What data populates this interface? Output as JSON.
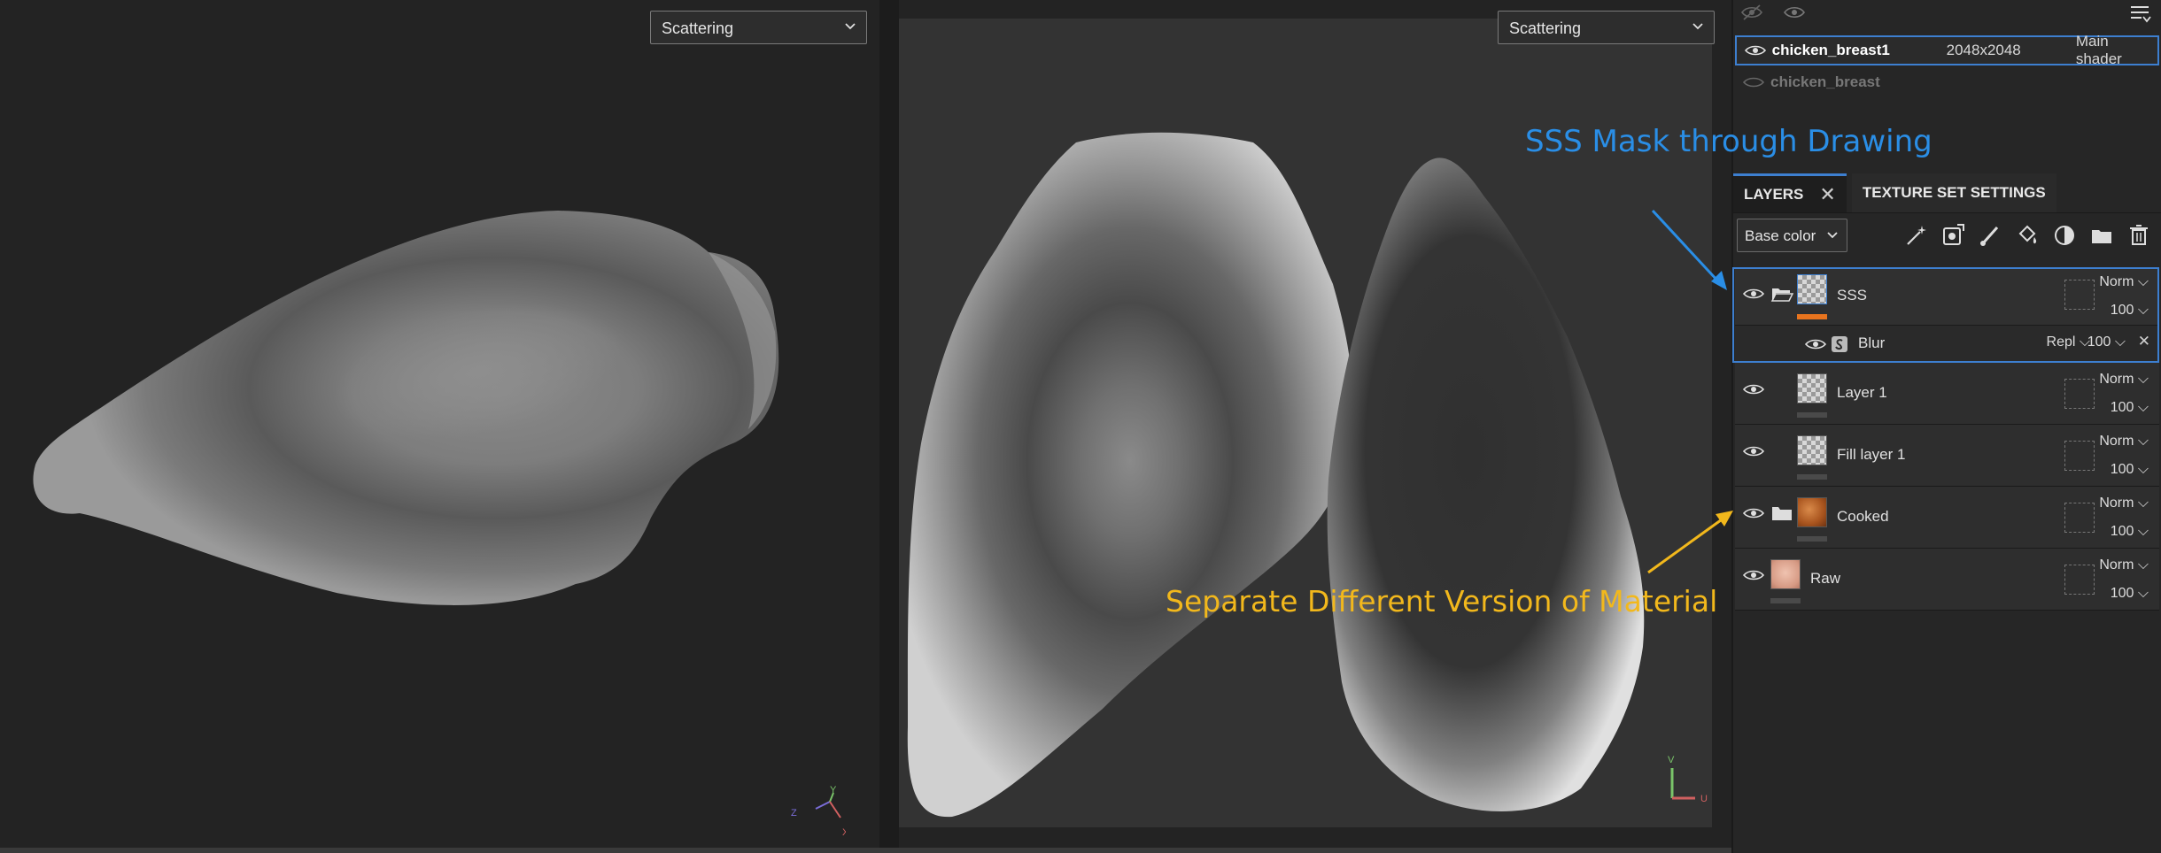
{
  "viewport3d": {
    "mode": "Scattering"
  },
  "viewport2d": {
    "mode": "Scattering"
  },
  "axes3d": {
    "x": "X",
    "y": "Y",
    "z": "Z"
  },
  "axes2d": {
    "u": "U",
    "v": "V"
  },
  "texture_sets": [
    {
      "name": "chicken_breast1",
      "resolution": "2048x2048",
      "shader": "Main shader",
      "visible": true
    },
    {
      "name": "chicken_breast",
      "resolution": "",
      "shader": "",
      "visible": false
    }
  ],
  "tabs": {
    "layers": "LAYERS",
    "texture_set_settings": "TEXTURE SET SETTINGS"
  },
  "channel": "Base color",
  "layers": [
    {
      "name": "SSS",
      "blend": "Norm",
      "opacity": "100",
      "effect": {
        "name": "Blur",
        "blend": "Repl",
        "opacity": "100"
      }
    },
    {
      "name": "Layer 1",
      "blend": "Norm",
      "opacity": "100"
    },
    {
      "name": "Fill layer 1",
      "blend": "Norm",
      "opacity": "100"
    },
    {
      "name": "Cooked",
      "blend": "Norm",
      "opacity": "100"
    },
    {
      "name": "Raw",
      "blend": "Norm",
      "opacity": "100"
    }
  ],
  "annotations": {
    "sss": "SSS Mask through Drawing",
    "separate": "Separate Different Version of Material"
  },
  "colors": {
    "accent": "#3d7fd0",
    "annot_blue": "#2a8ee6",
    "annot_orange": "#f2b81c",
    "sss_bar": "#e8741e"
  }
}
